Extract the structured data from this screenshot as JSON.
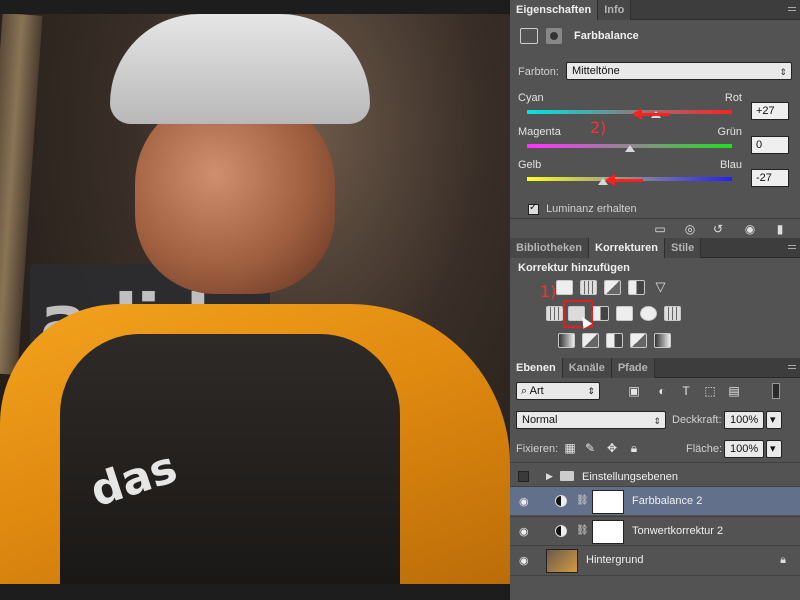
{
  "properties": {
    "tabs": [
      {
        "label": "Eigenschaften",
        "active": true
      },
      {
        "label": "Info",
        "active": false
      }
    ],
    "title": "Farbbalance",
    "tone_label": "Farbton:",
    "tone_value": "Mitteltöne",
    "sliders": [
      {
        "left": "Cyan",
        "right": "Rot",
        "value": "+27",
        "level_percent": 63,
        "gradient": [
          "#00e5e5",
          "#ff2020"
        ]
      },
      {
        "left": "Magenta",
        "right": "Grün",
        "value": "0",
        "level_percent": 50,
        "gradient": [
          "#ff30ff",
          "#20e020"
        ]
      },
      {
        "left": "Gelb",
        "right": "Blau",
        "value": "-27",
        "level_percent": 37,
        "gradient": [
          "#ffff20",
          "#2020ff"
        ]
      }
    ],
    "luminance_label": "Luminanz erhalten",
    "luminance_checked": true,
    "annotation_2": "2)"
  },
  "adjustments": {
    "tabs": [
      {
        "label": "Bibliotheken",
        "active": false
      },
      {
        "label": "Korrekturen",
        "active": true
      },
      {
        "label": "Stile",
        "active": false
      }
    ],
    "title": "Korrektur hinzufügen",
    "annotation_1": "1)"
  },
  "layers": {
    "tabs": [
      {
        "label": "Ebenen",
        "active": true
      },
      {
        "label": "Kanäle",
        "active": false
      },
      {
        "label": "Pfade",
        "active": false
      }
    ],
    "filter_value": "Art",
    "blend_mode": "Normal",
    "opacity_label": "Deckkraft:",
    "opacity_value": "100%",
    "lock_label": "Fixieren:",
    "fill_label": "Fläche:",
    "fill_value": "100%",
    "items": [
      {
        "name": "Einstellungsebenen",
        "type": "group",
        "visible": false
      },
      {
        "name": "Farbbalance 2",
        "type": "adjustment",
        "visible": true,
        "selected": true
      },
      {
        "name": "Tonwertkorrektur 2",
        "type": "adjustment",
        "visible": true,
        "selected": false
      },
      {
        "name": "Hintergrund",
        "type": "image",
        "visible": true,
        "selected": false,
        "locked": true
      }
    ]
  },
  "colors": {
    "accent_selected_layer": "#63708c",
    "annotation": "#ff2020"
  }
}
